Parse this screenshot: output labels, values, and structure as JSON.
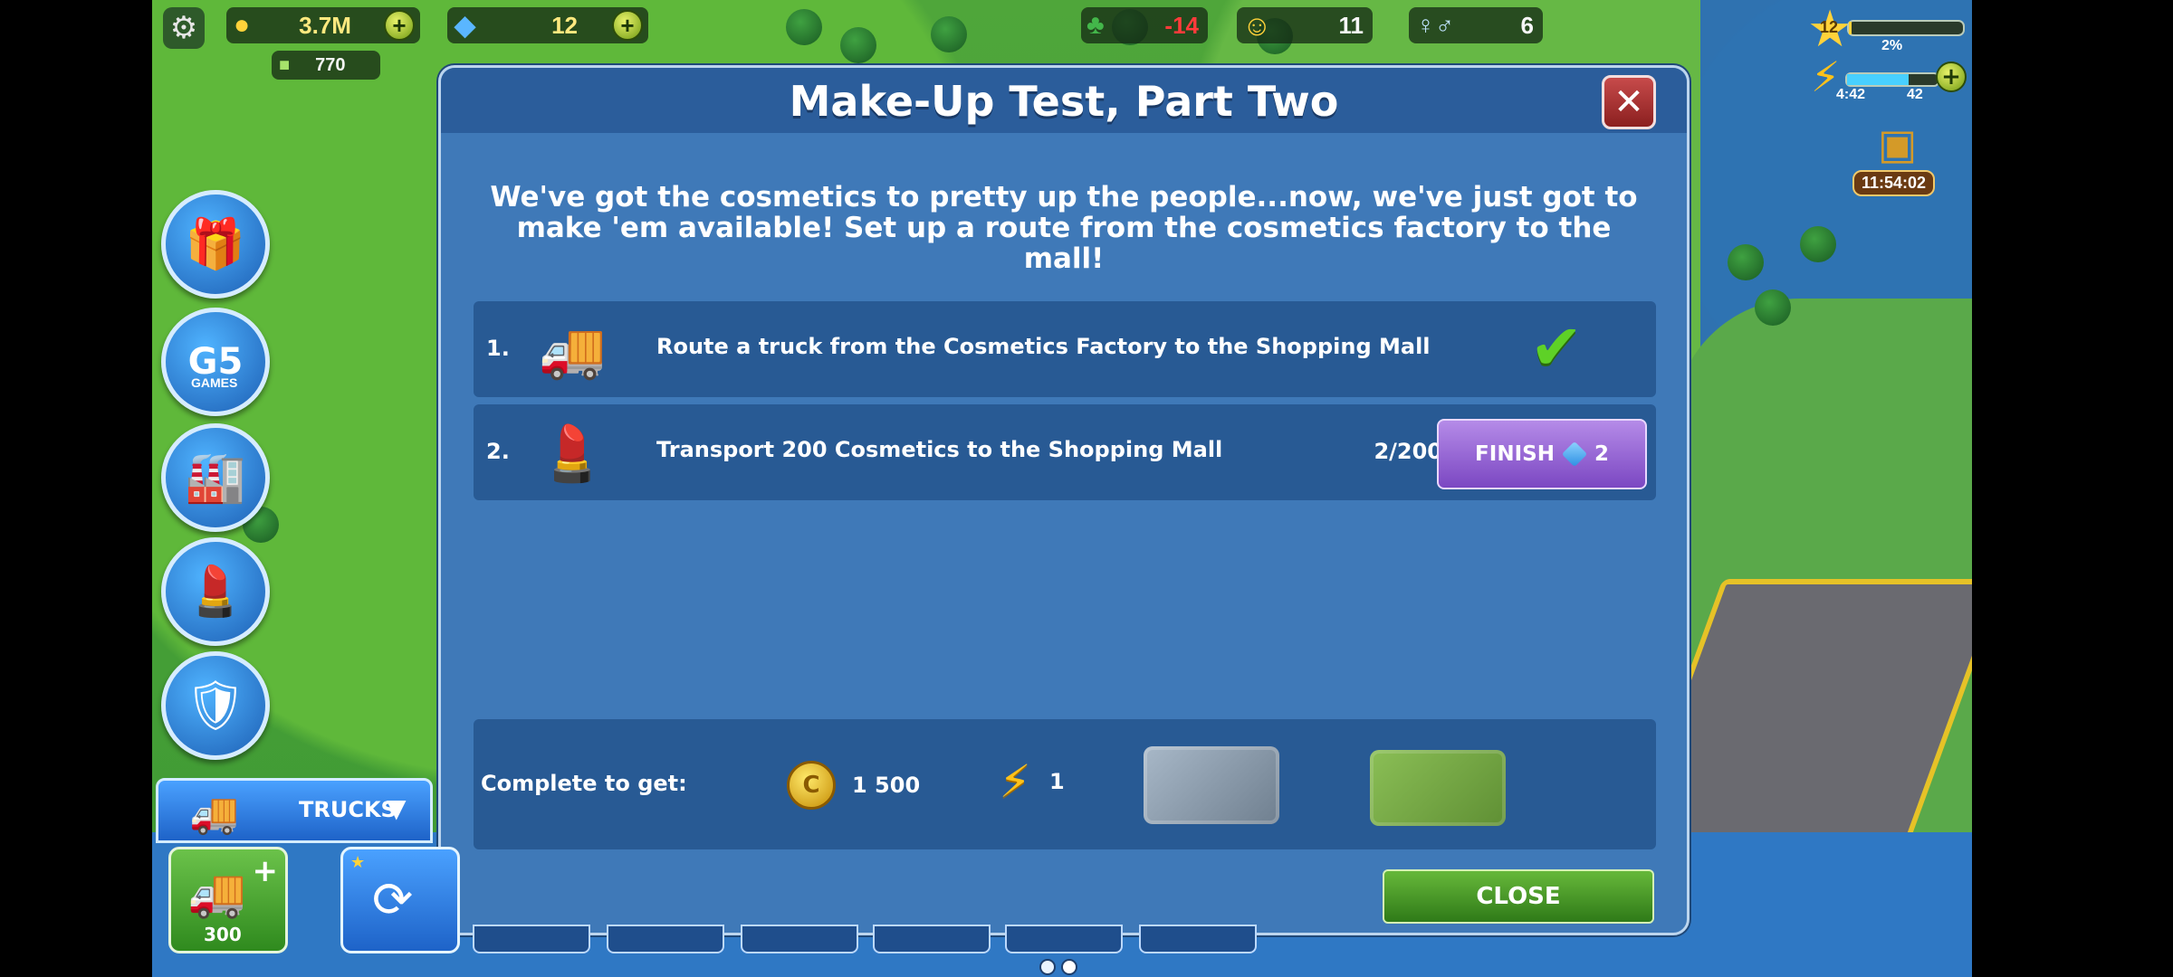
{
  "hud": {
    "coins": "3.7M",
    "gems": "12",
    "cash": "770",
    "trees": "-14",
    "happiness": "11",
    "population": "6",
    "level": "12",
    "xp_percent": "2%",
    "energy_timer": "4:42",
    "energy_value": "42",
    "chest_timer": "11:54:02"
  },
  "modal": {
    "title": "Make-Up Test, Part Two",
    "description": "We've got the cosmetics to pretty up the people...now, we've just got to make 'em available! Set up a route from the cosmetics factory to the mall!",
    "quests": [
      {
        "number": "1.",
        "text": "Route a truck from the Cosmetics Factory to the Shopping Mall",
        "done": true
      },
      {
        "number": "2.",
        "text": "Transport 200 Cosmetics to the Shopping Mall",
        "progress": "2/200",
        "finish_label": "FINISH",
        "finish_cost": "2"
      }
    ],
    "reward_label": "Complete to get:",
    "rewards": {
      "coins": "1 500",
      "energy": "1"
    },
    "close_label": "CLOSE"
  },
  "sidebar": {
    "g5_label": "GAMES"
  },
  "bottom": {
    "trucks_label": "TRUCKS",
    "add_truck_cost": "300"
  },
  "icons": [
    "settings-icon",
    "coin-icon",
    "gem-icon",
    "tree-icon",
    "smile-icon",
    "people-icon",
    "star-icon",
    "energy-icon",
    "chest-icon",
    "gift-icon",
    "truck-icon",
    "lipstick-icon",
    "shield-icon",
    "chevron-down-icon",
    "check-icon"
  ],
  "colors": {
    "modal_bg": "#3f79b8",
    "panel_bg": "#285a94",
    "finish_purple": "#8f5bd3",
    "close_green": "#3f9a24"
  }
}
